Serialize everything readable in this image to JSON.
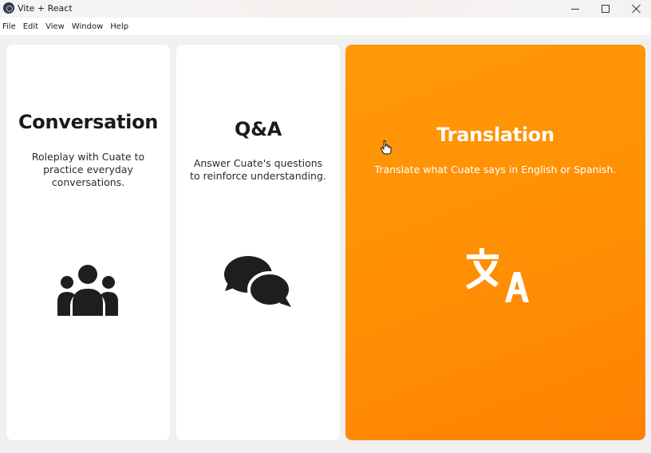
{
  "window": {
    "title": "Vite + React",
    "app_icon": "vite-app-icon"
  },
  "menu": {
    "items": [
      "File",
      "Edit",
      "View",
      "Window",
      "Help"
    ]
  },
  "cards": {
    "conversation": {
      "title": "Conversation",
      "description": "Roleplay with Cuate to practice everyday conversations.",
      "icon": "users-icon"
    },
    "qa": {
      "title": "Q&A",
      "description": "Answer Cuate's questions to reinforce understanding.",
      "icon": "comments-icon"
    },
    "translation": {
      "title": "Translation",
      "description": "Translate what Cuate says in English or Spanish.",
      "icon": "translate-icon",
      "color": "#ff8f05"
    }
  }
}
